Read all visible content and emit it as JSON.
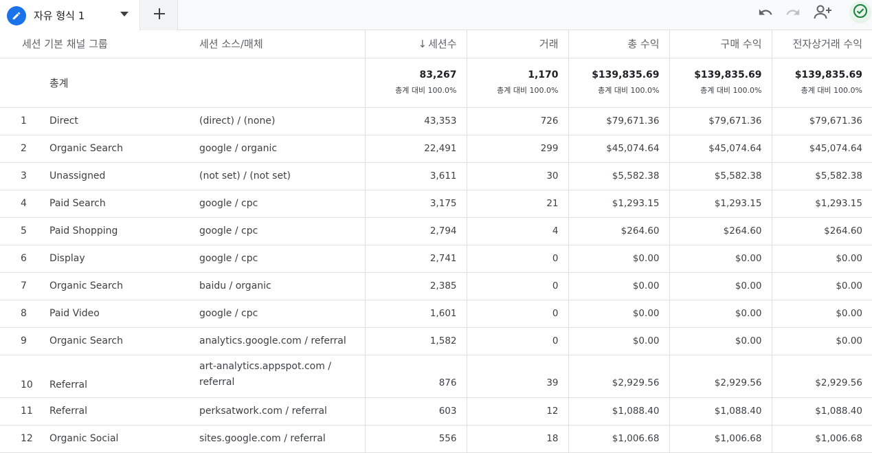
{
  "tab": {
    "label": "자유 형식 1",
    "icons": {
      "tab": "pencil-icon",
      "caret": "caret-down-icon",
      "add": "plus-icon"
    }
  },
  "toolbar": {
    "icons": [
      "undo-icon",
      "redo-icon",
      "share-users-icon",
      "check-circle-icon"
    ]
  },
  "colors": {
    "accent": "#1a73e8",
    "success": "#188038",
    "border": "#e0e0e0"
  },
  "table": {
    "headers": {
      "channel": "세션 기본 채널 그룹",
      "source": "세션 소스/매체",
      "sessions": "세션수",
      "transactions": "거래",
      "total_revenue": "총 수익",
      "purchase_revenue": "구매 수익",
      "ecommerce_revenue": "전자상거래 수익"
    },
    "sort_indicator": "↓",
    "total": {
      "label": "총계",
      "sessions": "83,267",
      "transactions": "1,170",
      "total_revenue": "$139,835.69",
      "purchase_revenue": "$139,835.69",
      "ecommerce_revenue": "$139,835.69",
      "pct_label": "총계 대비 100.0%"
    },
    "rows": [
      {
        "idx": "1",
        "channel": "Direct",
        "source": "(direct) / (none)",
        "sessions": "43,353",
        "transactions": "726",
        "total_revenue": "$79,671.36",
        "purchase_revenue": "$79,671.36",
        "ecommerce_revenue": "$79,671.36"
      },
      {
        "idx": "2",
        "channel": "Organic Search",
        "source": "google / organic",
        "sessions": "22,491",
        "transactions": "299",
        "total_revenue": "$45,074.64",
        "purchase_revenue": "$45,074.64",
        "ecommerce_revenue": "$45,074.64"
      },
      {
        "idx": "3",
        "channel": "Unassigned",
        "source": "(not set) / (not set)",
        "sessions": "3,611",
        "transactions": "30",
        "total_revenue": "$5,582.38",
        "purchase_revenue": "$5,582.38",
        "ecommerce_revenue": "$5,582.38"
      },
      {
        "idx": "4",
        "channel": "Paid Search",
        "source": "google / cpc",
        "sessions": "3,175",
        "transactions": "21",
        "total_revenue": "$1,293.15",
        "purchase_revenue": "$1,293.15",
        "ecommerce_revenue": "$1,293.15"
      },
      {
        "idx": "5",
        "channel": "Paid Shopping",
        "source": "google / cpc",
        "sessions": "2,794",
        "transactions": "4",
        "total_revenue": "$264.60",
        "purchase_revenue": "$264.60",
        "ecommerce_revenue": "$264.60"
      },
      {
        "idx": "6",
        "channel": "Display",
        "source": "google / cpc",
        "sessions": "2,741",
        "transactions": "0",
        "total_revenue": "$0.00",
        "purchase_revenue": "$0.00",
        "ecommerce_revenue": "$0.00"
      },
      {
        "idx": "7",
        "channel": "Organic Search",
        "source": "baidu / organic",
        "sessions": "2,385",
        "transactions": "0",
        "total_revenue": "$0.00",
        "purchase_revenue": "$0.00",
        "ecommerce_revenue": "$0.00"
      },
      {
        "idx": "8",
        "channel": "Paid Video",
        "source": "google / cpc",
        "sessions": "1,601",
        "transactions": "0",
        "total_revenue": "$0.00",
        "purchase_revenue": "$0.00",
        "ecommerce_revenue": "$0.00"
      },
      {
        "idx": "9",
        "channel": "Organic Search",
        "source": "analytics.google.com / referral",
        "sessions": "1,582",
        "transactions": "0",
        "total_revenue": "$0.00",
        "purchase_revenue": "$0.00",
        "ecommerce_revenue": "$0.00"
      },
      {
        "idx": "10",
        "channel": "Referral",
        "source": "art-analytics.appspot.com / referral",
        "sessions": "876",
        "transactions": "39",
        "total_revenue": "$2,929.56",
        "purchase_revenue": "$2,929.56",
        "ecommerce_revenue": "$2,929.56"
      },
      {
        "idx": "11",
        "channel": "Referral",
        "source": "perksatwork.com / referral",
        "sessions": "603",
        "transactions": "12",
        "total_revenue": "$1,088.40",
        "purchase_revenue": "$1,088.40",
        "ecommerce_revenue": "$1,088.40"
      },
      {
        "idx": "12",
        "channel": "Organic Social",
        "source": "sites.google.com / referral",
        "sessions": "556",
        "transactions": "18",
        "total_revenue": "$1,006.68",
        "purchase_revenue": "$1,006.68",
        "ecommerce_revenue": "$1,006.68"
      }
    ]
  }
}
